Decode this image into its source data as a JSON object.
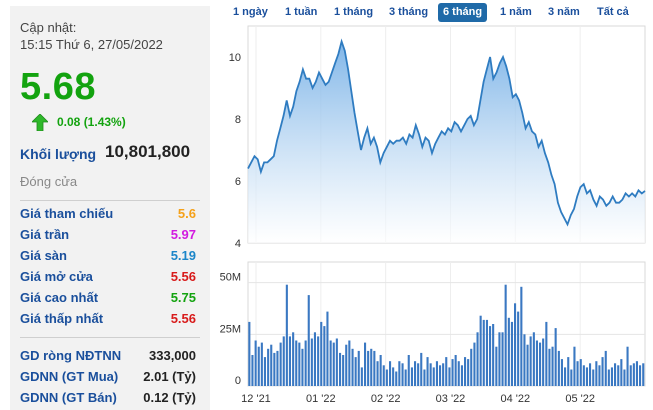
{
  "info": {
    "update_label": "Cập nhật:",
    "update_time": "15:15 Thứ 6, 27/05/2022",
    "price": "5.68",
    "change": "0.08 (1.43%)",
    "volume_label": "Khối lượng",
    "volume_value": "10,801,800",
    "status": "Đóng cửa"
  },
  "price_rows": [
    {
      "label": "Giá tham chiếu",
      "value": "5.6",
      "color": "#f5a11a"
    },
    {
      "label": "Giá trần",
      "value": "5.97",
      "color": "#d21be0"
    },
    {
      "label": "Giá sàn",
      "value": "5.19",
      "color": "#1b86c9"
    },
    {
      "label": "Giá mở cửa",
      "value": "5.56",
      "color": "#d81b1b"
    },
    {
      "label": "Giá cao nhất",
      "value": "5.75",
      "color": "#13a30f"
    },
    {
      "label": "Giá thấp nhất",
      "value": "5.56",
      "color": "#d81b1b"
    }
  ],
  "foreign_rows": [
    {
      "label": "GD ròng NĐTNN",
      "value": "333,000"
    },
    {
      "label": "GDNN (GT Mua)",
      "value": "2.01 (Tỷ)"
    },
    {
      "label": "GDNN (GT Bán)",
      "value": "0.12 (Tỷ)"
    }
  ],
  "tabs": [
    "1 ngày",
    "1 tuần",
    "1 tháng",
    "3 tháng",
    "6 tháng",
    "1 năm",
    "3 năm",
    "Tất cả"
  ],
  "active_tab": 4,
  "colors": {
    "up": "#13a30f",
    "label": "#1a4f9c",
    "line": "#2f7cc1",
    "bar": "#3a78c2"
  },
  "chart_data": [
    {
      "type": "area",
      "ylim": [
        4,
        11
      ],
      "yticks": [
        "4",
        "6",
        "8",
        "10"
      ],
      "x_labels": [
        "12 '21",
        "01 '22",
        "02 '22",
        "03 '22",
        "04 '22",
        "05 '22"
      ],
      "values": [
        6.4,
        6.6,
        6.8,
        6.7,
        6.3,
        6.6,
        6.6,
        6.7,
        6.8,
        7.3,
        7.7,
        8.1,
        8.6,
        8.1,
        8.4,
        8.9,
        9.2,
        9.6,
        9.3,
        9.3,
        9.0,
        9.2,
        9.5,
        9.3,
        9.1,
        9.2,
        9.5,
        9.8,
        10.1,
        10.5,
        10.2,
        9.6,
        8.9,
        8.2,
        7.6,
        7.0,
        7.4,
        7.7,
        7.2,
        7.4,
        7.1,
        6.6,
        6.9,
        7.1,
        7.3,
        7.2,
        7.3,
        7.3,
        7.4,
        7.2,
        7.5,
        7.4,
        7.8,
        7.5,
        7.1,
        7.4,
        7.3,
        6.9,
        7.2,
        7.4,
        7.6,
        7.5,
        7.7,
        7.6,
        7.9,
        7.8,
        7.6,
        7.8,
        8.0,
        8.1,
        7.8,
        8.0,
        8.6,
        9.2,
        9.6,
        10.0,
        9.3,
        9.5,
        9.8,
        10.0,
        9.7,
        9.3,
        8.7,
        8.8,
        8.6,
        8.2,
        7.7,
        7.9,
        7.6,
        7.5,
        7.1,
        7.3,
        6.9,
        6.6,
        6.2,
        5.9,
        5.3,
        5.0,
        4.8,
        4.6,
        4.9,
        5.1,
        5.5,
        5.8,
        5.9,
        5.6,
        5.7,
        5.4,
        5.2,
        5.5,
        5.4,
        5.2,
        5.3,
        5.5,
        5.3,
        5.3,
        5.4,
        5.6,
        5.5,
        5.6,
        5.5,
        5.7,
        5.6,
        5.68
      ]
    },
    {
      "type": "bar",
      "ylim": [
        0,
        60
      ],
      "yticks": [
        "0",
        "25M",
        "50M"
      ],
      "values": [
        31,
        15,
        22,
        19,
        21,
        14,
        18,
        20,
        16,
        17,
        21,
        24,
        49,
        24,
        26,
        22,
        21,
        18,
        22,
        44,
        23,
        26,
        24,
        31,
        29,
        36,
        22,
        21,
        23,
        16,
        15,
        20,
        22,
        18,
        14,
        17,
        9,
        21,
        17,
        18,
        17,
        12,
        15,
        10,
        8,
        12,
        9,
        7,
        12,
        11,
        8,
        15,
        9,
        12,
        11,
        16,
        8,
        14,
        11,
        9,
        12,
        10,
        11,
        14,
        9,
        13,
        15,
        12,
        10,
        14,
        13,
        18,
        21,
        26,
        34,
        32,
        32,
        29,
        30,
        19,
        26,
        26,
        49,
        33,
        31,
        40,
        36,
        48,
        25,
        20,
        24,
        26,
        22,
        21,
        23,
        31,
        18,
        19,
        28,
        17,
        13,
        9,
        14,
        8,
        19,
        12,
        13,
        10,
        9,
        11,
        8,
        12,
        10,
        14,
        17,
        8,
        9,
        11,
        10,
        13,
        8,
        19,
        10,
        11,
        12,
        10,
        11
      ]
    }
  ]
}
